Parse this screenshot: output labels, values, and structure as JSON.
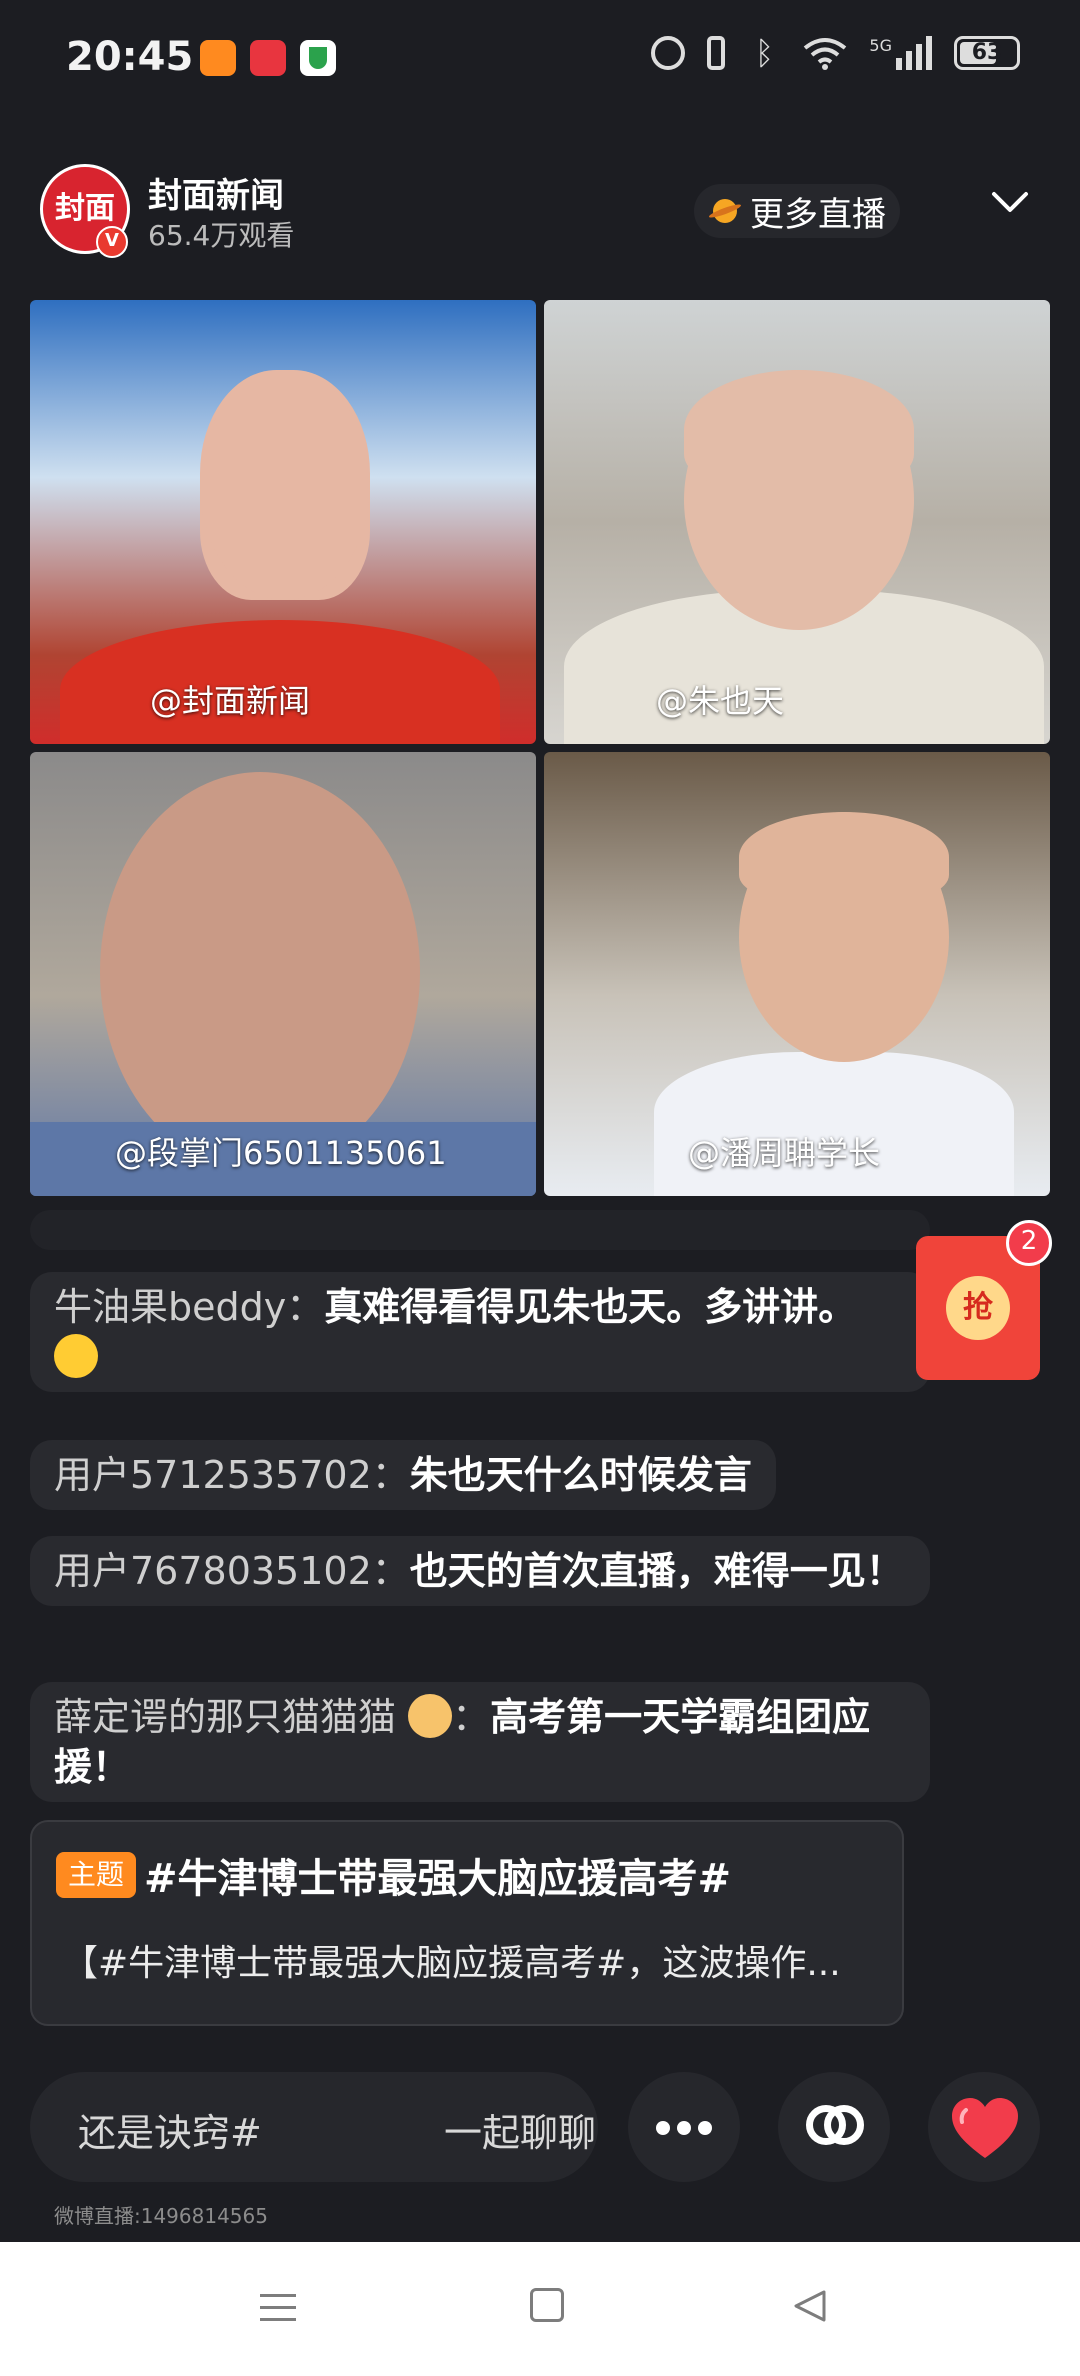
{
  "status_bar": {
    "time": "20:45",
    "network": "5G",
    "battery": "63"
  },
  "header": {
    "channel_name": "封面新闻",
    "viewer_count": "65.4万观看",
    "avatar_text": "封面",
    "verified_badge": "V",
    "more_live_label": "更多直播"
  },
  "videos": [
    {
      "label": "@封面新闻"
    },
    {
      "label": "@朱也天"
    },
    {
      "label": "@段掌门6501135061"
    },
    {
      "label": "@潘周聃学长"
    }
  ],
  "comments": [
    {
      "user": "牛油果beddy：",
      "text": "真难得看得见朱也天。多讲讲。"
    },
    {
      "user": "用户5712535702：",
      "text": "朱也天什么时候发言"
    },
    {
      "user": "用户7678035102：",
      "text": "也天的首次直播，难得一见！"
    },
    {
      "user": "薛定谔的那只猫猫猫",
      "sep": "：",
      "text": "高考第一天学霸组团应援！"
    }
  ],
  "red_packet": {
    "label": "抢",
    "badge": "2"
  },
  "topic": {
    "tag": "主题",
    "title": "#牛津博士带最强大脑应援高考#",
    "description": "【#牛津博士带最强大脑应援高考#，这波操作..."
  },
  "comment_input": {
    "placeholder_left": "还是诀窍#",
    "placeholder_right": "一起聊聊"
  },
  "live_id": "微博直播:1496814565",
  "colors": {
    "background": "#1c1d22",
    "accent_orange": "#ff8a1f",
    "like_red": "#f23c4b"
  }
}
